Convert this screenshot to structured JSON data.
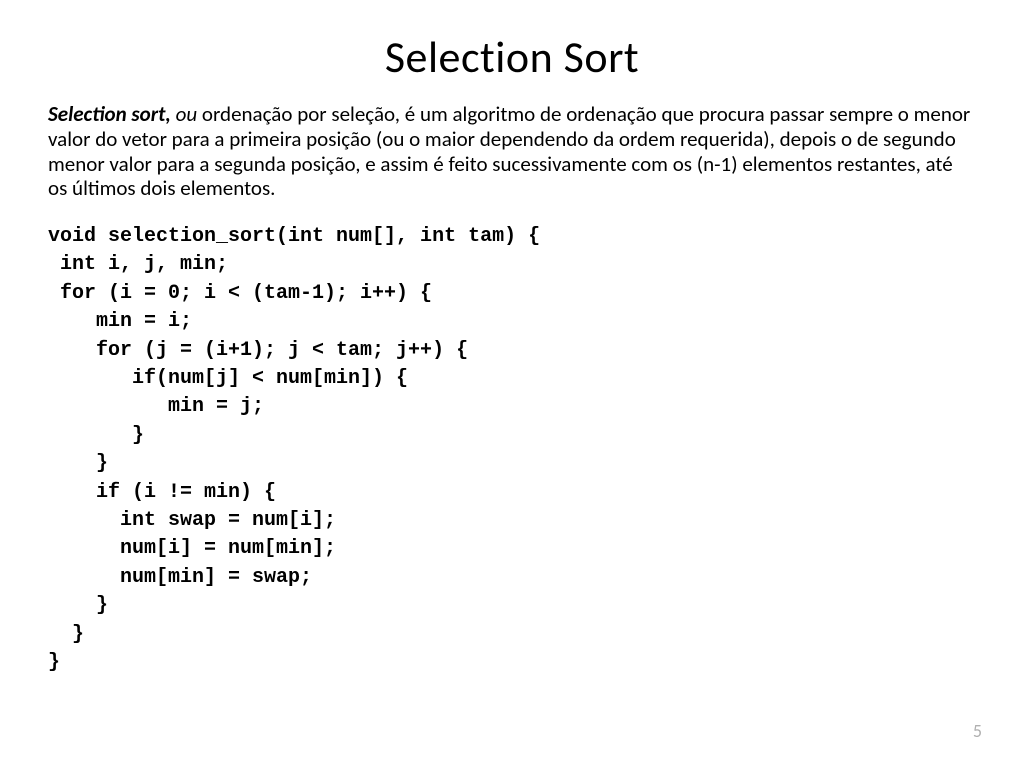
{
  "slide": {
    "title": "Selection Sort",
    "description": {
      "lead_bold": "Selection sort,",
      "lead_italic": " ou ",
      "body": "ordenação por seleção, é um algoritmo de ordenação que procura passar sempre o menor valor do vetor para a primeira posição (ou o maior dependendo da ordem requerida), depois o de segundo menor valor para a segunda posição, e assim é feito sucessivamente com os (n-1) elementos restantes, até os últimos dois elementos."
    },
    "code": "void selection_sort(int num[], int tam) {\n int i, j, min;\n for (i = 0; i < (tam-1); i++) {\n    min = i;\n    for (j = (i+1); j < tam; j++) {\n       if(num[j] < num[min]) {\n          min = j;\n       }\n    }\n    if (i != min) {\n      int swap = num[i];\n      num[i] = num[min];\n      num[min] = swap;\n    }\n  }\n}",
    "page_number": "5"
  }
}
